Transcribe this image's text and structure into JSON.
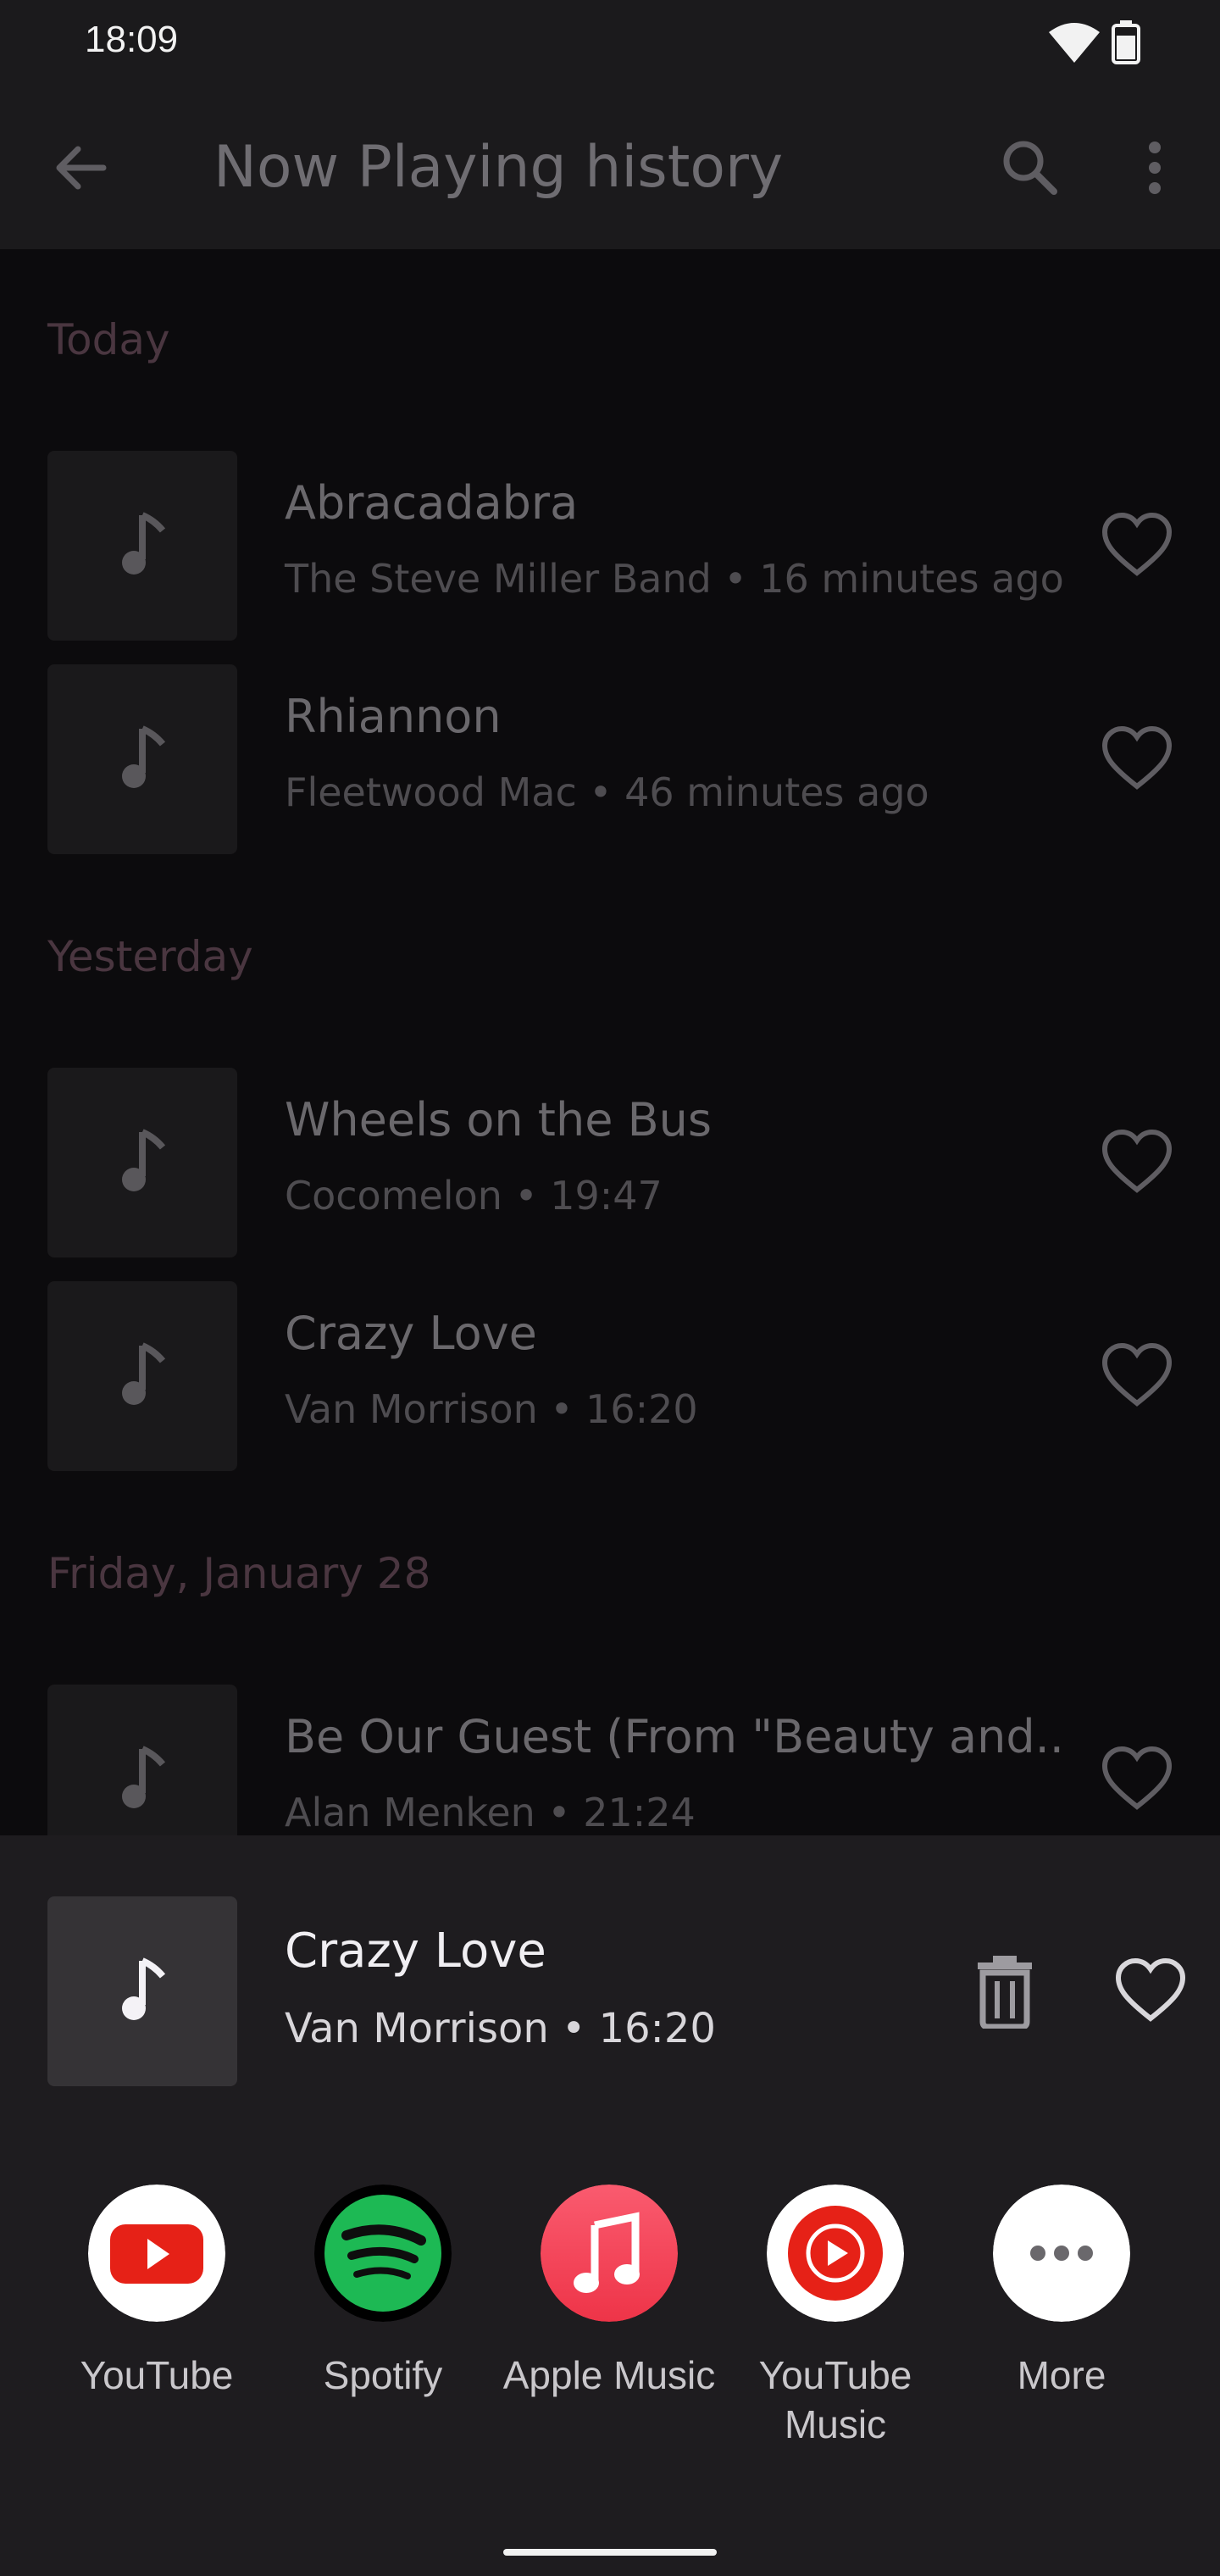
{
  "status_bar": {
    "time": "18:09"
  },
  "app_bar": {
    "title": "Now Playing history"
  },
  "sections": [
    {
      "header": "Today",
      "items": [
        {
          "title": "Abracadabra",
          "meta": "The Steve Miller Band • 16 minutes ago"
        },
        {
          "title": "Rhiannon",
          "meta": "Fleetwood Mac • 46 minutes ago"
        }
      ]
    },
    {
      "header": "Yesterday",
      "items": [
        {
          "title": "Wheels on the Bus",
          "meta": "Cocomelon • 19:47"
        },
        {
          "title": "Crazy Love",
          "meta": "Van Morrison • 16:20"
        }
      ]
    },
    {
      "header": "Friday, January 28",
      "items": [
        {
          "title": "Be Our Guest (From \"Beauty and..",
          "meta": "Alan Menken • 21:24"
        }
      ]
    }
  ],
  "sheet": {
    "title": "Crazy Love",
    "meta": "Van Morrison • 16:20",
    "apps": [
      {
        "label": "YouTube",
        "icon": "youtube-icon",
        "color": "#e62117"
      },
      {
        "label": "Spotify",
        "icon": "spotify-icon",
        "color": "#1db954"
      },
      {
        "label": "Apple Music",
        "icon": "apple-music-icon",
        "color": "#f0455a"
      },
      {
        "label": "YouTube Music",
        "icon": "youtube-music-icon",
        "color": "#e62117"
      },
      {
        "label": "More",
        "icon": "more-icon",
        "color": "#ffffff"
      }
    ]
  },
  "colors": {
    "accent_header": "#4a3640",
    "background": "#0c0b0d",
    "sheet_background": "#1e1c1f"
  }
}
